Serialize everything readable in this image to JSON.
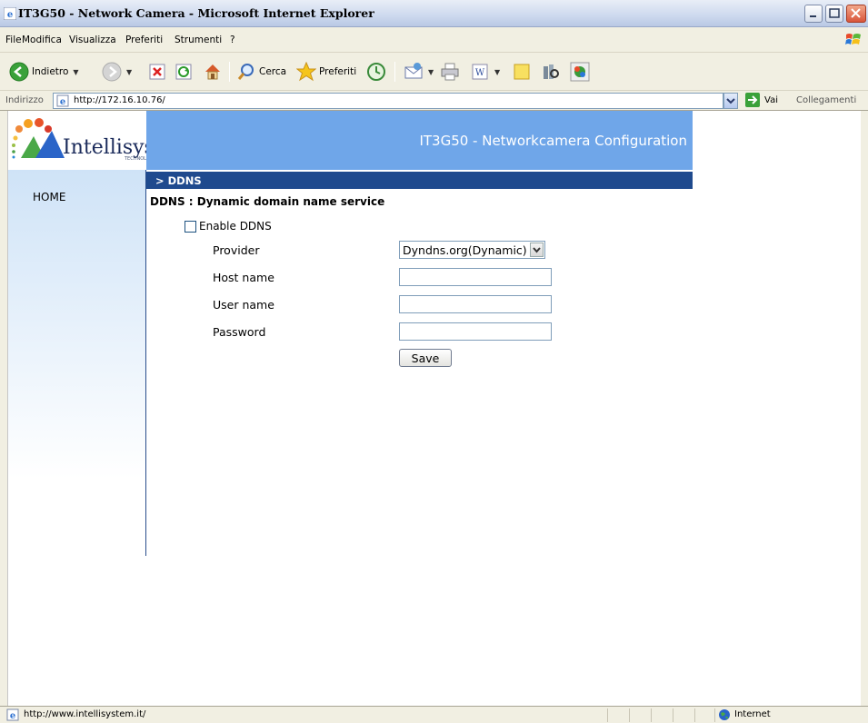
{
  "window": {
    "title": "IT3G50 - Network Camera - Microsoft Internet Explorer"
  },
  "menu": {
    "items": [
      "File",
      "Modifica",
      "Visualizza",
      "Preferiti",
      "Strumenti",
      "?"
    ]
  },
  "toolbar": {
    "back_label": "Indietro",
    "search_label": "Cerca",
    "favorites_label": "Preferiti"
  },
  "address": {
    "label": "Indirizzo",
    "url": "http://172.16.10.76/",
    "go_label": "Vai",
    "links_label": "Collegamenti"
  },
  "page": {
    "logo_text": "Intellisystem",
    "logo_sub": "TECHNOLOGIES",
    "header_title": "IT3G50 - Networkcamera Configuration",
    "section_title": "> DDNS",
    "sidebar_home": "HOME",
    "content_title": "DDNS : Dynamic domain name service",
    "enable_label": "Enable DDNS",
    "enable_checked": false,
    "provider_label": "Provider",
    "provider_value": "Dyndns.org(Dynamic)",
    "hostname_label": "Host name",
    "hostname_value": "",
    "username_label": "User name",
    "username_value": "",
    "password_label": "Password",
    "password_value": "",
    "save_label": "Save"
  },
  "status": {
    "text": "http://www.intellisystem.it/",
    "zone": "Internet"
  },
  "colors": {
    "header_blue": "#6fa6e9",
    "section_navy": "#1f4a8e"
  }
}
